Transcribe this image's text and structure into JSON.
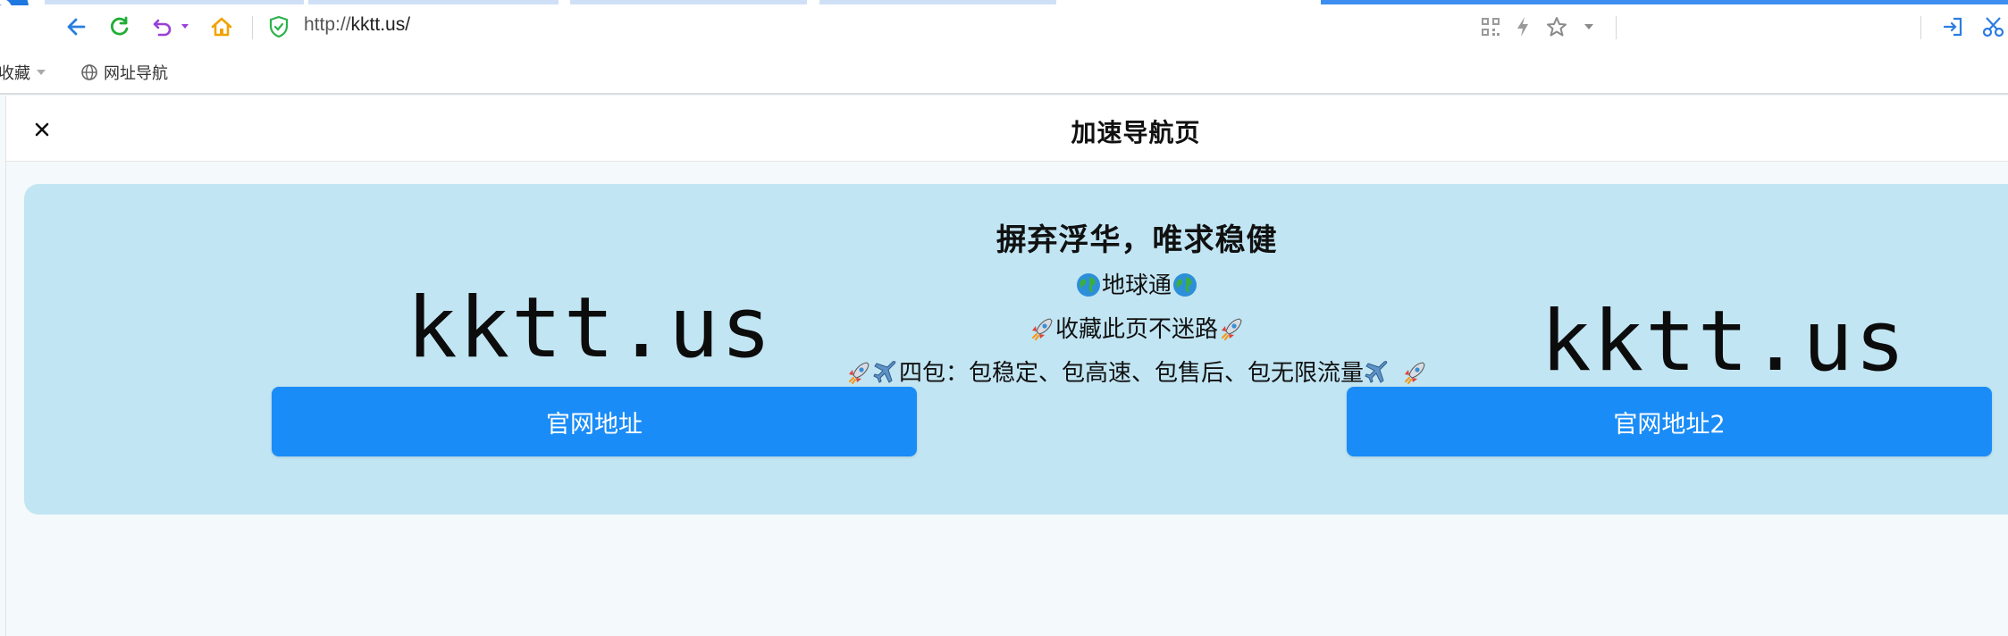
{
  "browser": {
    "url_protocol": "http://",
    "url_host": "kktt.us/",
    "bookmarks": [
      {
        "label": "收藏"
      },
      {
        "label": "网址导航"
      }
    ],
    "colors": {
      "accent": "#3d8ef0",
      "secure": "#2ab34a",
      "refresh": "#1fae36",
      "home": "#f2a300",
      "undo": "#9b3fd8"
    }
  },
  "modal": {
    "title": "加速导航页"
  },
  "card": {
    "logo_left": "kktt.us",
    "logo_right": "kktt.us",
    "headline": "摒弃浮华，唯求稳健",
    "line1": "地球通",
    "line2": "收藏此页不迷路",
    "line3": "四包：包稳定、包高速、包售后、包无限流量",
    "button1": "官网地址",
    "button2": "官网地址2",
    "colors": {
      "background": "#c1e5f3",
      "button": "#1a8cf7"
    }
  }
}
